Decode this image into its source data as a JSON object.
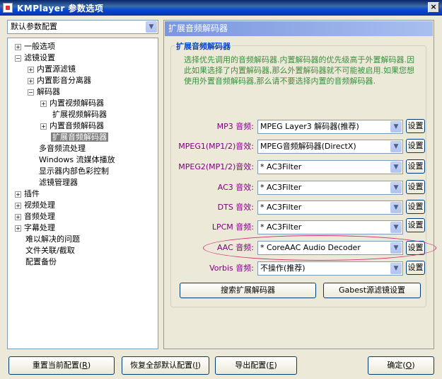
{
  "window": {
    "title": "KMPlayer 参数选项",
    "close_label": "×"
  },
  "profile_combo": {
    "value": "默认参数配置"
  },
  "tree": [
    {
      "label": "一般选项",
      "expander": "+"
    },
    {
      "label": "滤镜设置",
      "expander": "−"
    },
    {
      "label": "内置源滤镜",
      "expander": "+"
    },
    {
      "label": "内置影音分离器",
      "expander": "+"
    },
    {
      "label": "解码器",
      "expander": "−"
    },
    {
      "label": "内置视频解码器",
      "expander": "+"
    },
    {
      "label": "扩展视频解码器",
      "expander": ""
    },
    {
      "label": "内置音频解码器",
      "expander": "+"
    },
    {
      "label": "扩展音频解码器",
      "expander": "",
      "selected": true
    },
    {
      "label": "多音频流处理",
      "expander": ""
    },
    {
      "label": "Windows 流媒体播放",
      "expander": ""
    },
    {
      "label": "显示器内部色彩控制",
      "expander": ""
    },
    {
      "label": "滤镜管理器",
      "expander": ""
    },
    {
      "label": "插件",
      "expander": "+"
    },
    {
      "label": "视频处理",
      "expander": "+"
    },
    {
      "label": "音频处理",
      "expander": "+"
    },
    {
      "label": "字幕处理",
      "expander": "+"
    },
    {
      "label": "难以解决的问题",
      "expander": ""
    },
    {
      "label": "文件关联/截取",
      "expander": ""
    },
    {
      "label": "配置备份",
      "expander": ""
    }
  ],
  "panel": {
    "header": "扩展音频解码器",
    "group_title": "扩展音频解码器",
    "description": "选择优先调用的音频解码器.内置解码器的优先级高于外置解码器.因此如果选择了内置解码器,那么外置解码器就不可能被启用.如果您想使用外置音频解码器,那么请不要选择内置的音频解码器."
  },
  "decoders": [
    {
      "label": "MP3 音频:",
      "value": "MPEG Layer3 解码器(推荐)",
      "button": "设置"
    },
    {
      "label": "MPEG1(MP1/2)音效:",
      "value": "MPEG音频解码器(DirectX)",
      "button": "设置"
    },
    {
      "label": "MPEG2(MP1/2)音效:",
      "value": "* AC3Filter",
      "button": "设置"
    },
    {
      "label": "AC3 音效:",
      "value": "* AC3Filter",
      "button": "设置"
    },
    {
      "label": "DTS 音效:",
      "value": "* AC3Filter",
      "button": "设置"
    },
    {
      "label": "LPCM 音频:",
      "value": "* AC3Filter",
      "button": "设置"
    },
    {
      "label": "AAC 音频:",
      "value": "* CoreAAC Audio Decoder",
      "button": "设置"
    },
    {
      "label": "Vorbis 音频:",
      "value": "不操作(推荐)",
      "button": "设置"
    }
  ],
  "panel_buttons": {
    "search": "搜索扩展解码器",
    "gabest": "Gabest源滤镜设置"
  },
  "footer": {
    "reset_label": "重置当前配置(",
    "reset_key": "R",
    "restore_label": "恢复全部默认配置(",
    "restore_key": "I",
    "export_label": "导出配置(",
    "export_key": "E",
    "ok_label": "确定(",
    "ok_key": "O",
    "close_paren": ")"
  }
}
